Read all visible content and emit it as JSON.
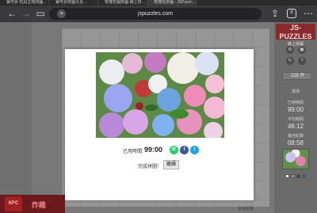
{
  "browser": {
    "tabs": [
      "寶可夢 玩具主題拼圖...",
      "寶可夢拼圖大全...",
      "玫瑰花園拼圖-線上拼...",
      "玫瑰花拼圖 - JSPuzzl..."
    ],
    "url": "jspuzzles.com",
    "tab_count": "8",
    "icons": [
      "back-icon",
      "forward-icon",
      "sidebar-icon",
      "share-icon",
      "tabs-icon",
      "menu-icon"
    ]
  },
  "side_panel": {
    "logo_main": "JS-PUZZLES",
    "logo_sub": "線上拼圖",
    "size_select": "225 片",
    "options_label": "選項",
    "elapsed_label": "已用時間",
    "elapsed_value": "99:00",
    "average_label": "平均時間",
    "average_value": "46:12",
    "best_label": "最佳紀錄",
    "best_value": "08:58"
  },
  "ad": {
    "brand": "KFC",
    "text": "炸雞"
  },
  "bottom_note": "快速解鎖",
  "modal": {
    "time_label": "已用時間:",
    "time_value": "99:00",
    "share": {
      "whatsapp": "✆",
      "facebook": "f",
      "twitter": "t"
    },
    "done_label": "完成拼圖！",
    "continue_label": "繼續"
  },
  "colors": {
    "whatsapp": "#25d366",
    "facebook": "#3b5998",
    "twitter": "#1da1f2"
  }
}
